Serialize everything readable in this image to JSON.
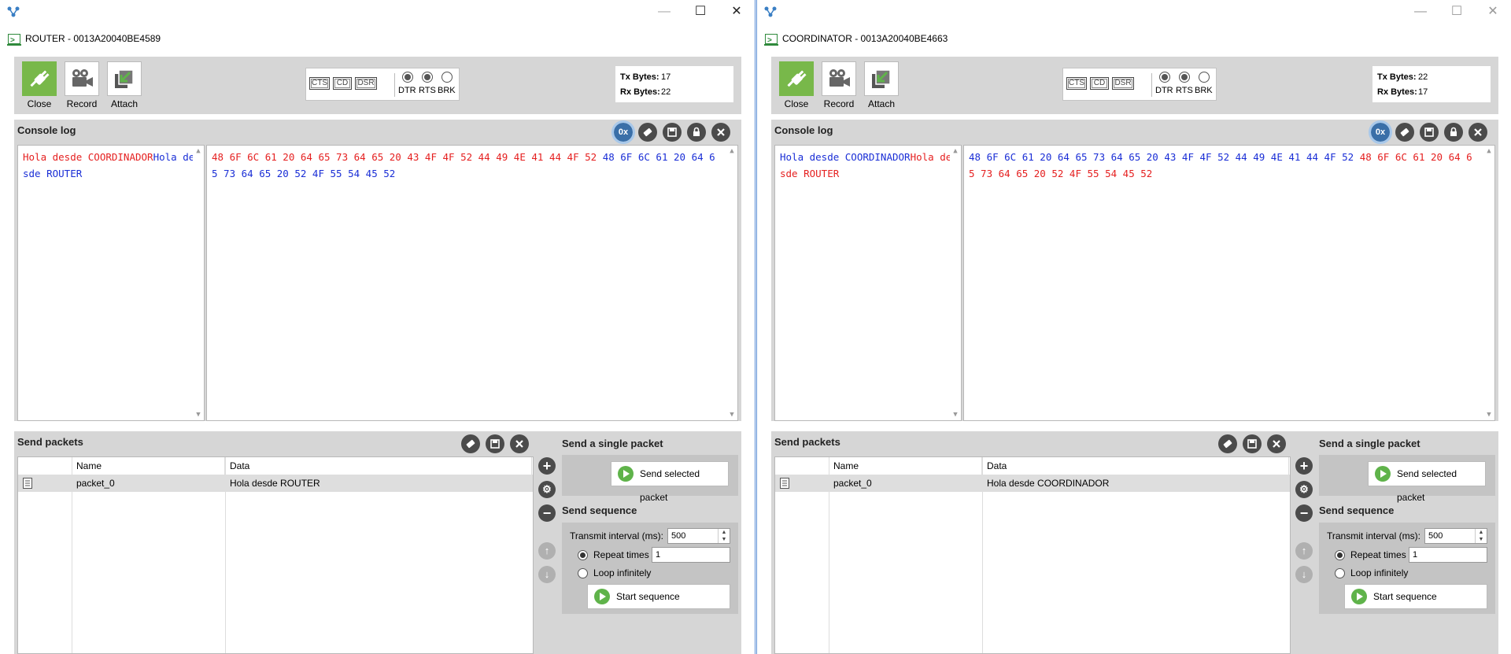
{
  "windows": [
    {
      "side": "left",
      "device_title": "ROUTER - 0013A20040BE4589",
      "toolbar": {
        "close_label": "Close",
        "record_label": "Record",
        "attach_label": "Attach",
        "signals": {
          "cts": "CTS",
          "cd": "CD",
          "dsr": "DSR",
          "dtr": "DTR",
          "rts": "RTS",
          "brk": "BRK"
        },
        "tx_label": "Tx Bytes:",
        "tx_value": "17",
        "rx_label": "Rx Bytes:",
        "rx_value": "22"
      },
      "console": {
        "title": "Console log",
        "icon_hex": "0x",
        "text": [
          {
            "t": "Hola desde COORDINADOR",
            "c": "red"
          },
          {
            "t": "Hola desde ROUTER",
            "c": "blue"
          }
        ],
        "hex": [
          {
            "t": "48 6F 6C 61 20 64 65 73 64 65 20 43 4F 4F 52 44 49 4E 41 44 4F 52",
            "c": "red"
          },
          {
            "t": "48 6F 6C 61 20 64 65 73 64 65 20 52 4F 55 54 45 52",
            "c": "blue"
          }
        ]
      },
      "send": {
        "title": "Send packets",
        "col_name": "Name",
        "col_data": "Data",
        "row_name": "packet_0",
        "row_data": "Hola desde ROUTER",
        "single_title": "Send a single packet",
        "send_selected": "Send selected packet",
        "sequence_title": "Send sequence",
        "interval_label": "Transmit interval (ms):",
        "interval_value": "500",
        "repeat_label": "Repeat times",
        "repeat_value": "1",
        "loop_label": "Loop infinitely",
        "start_label": "Start sequence"
      }
    },
    {
      "side": "right",
      "device_title": "COORDINATOR - 0013A20040BE4663",
      "toolbar": {
        "close_label": "Close",
        "record_label": "Record",
        "attach_label": "Attach",
        "signals": {
          "cts": "CTS",
          "cd": "CD",
          "dsr": "DSR",
          "dtr": "DTR",
          "rts": "RTS",
          "brk": "BRK"
        },
        "tx_label": "Tx Bytes:",
        "tx_value": "22",
        "rx_label": "Rx Bytes:",
        "rx_value": "17"
      },
      "console": {
        "title": "Console log",
        "icon_hex": "0x",
        "text": [
          {
            "t": "Hola desde COORDINADOR",
            "c": "blue"
          },
          {
            "t": "Hola desde ROUTER",
            "c": "red"
          }
        ],
        "hex": [
          {
            "t": "48 6F 6C 61 20 64 65 73 64 65 20 43 4F 4F 52 44 49 4E 41 44 4F 52",
            "c": "blue"
          },
          {
            "t": "48 6F 6C 61 20 64 65 73 64 65 20 52 4F 55 54 45 52",
            "c": "red"
          }
        ]
      },
      "send": {
        "title": "Send packets",
        "col_name": "Name",
        "col_data": "Data",
        "row_name": "packet_0",
        "row_data": "Hola desde COORDINADOR",
        "single_title": "Send a single packet",
        "send_selected": "Send selected packet",
        "sequence_title": "Send sequence",
        "interval_label": "Transmit interval (ms):",
        "interval_value": "500",
        "repeat_label": "Repeat times",
        "repeat_value": "1",
        "loop_label": "Loop infinitely",
        "start_label": "Start sequence"
      }
    }
  ],
  "colors": {
    "sent": "#e52020",
    "received": "#1a2ed6",
    "accent_green": "#78b84a"
  },
  "window_controls": {
    "minimize": "—",
    "maximize": "☐",
    "close": "✕"
  }
}
